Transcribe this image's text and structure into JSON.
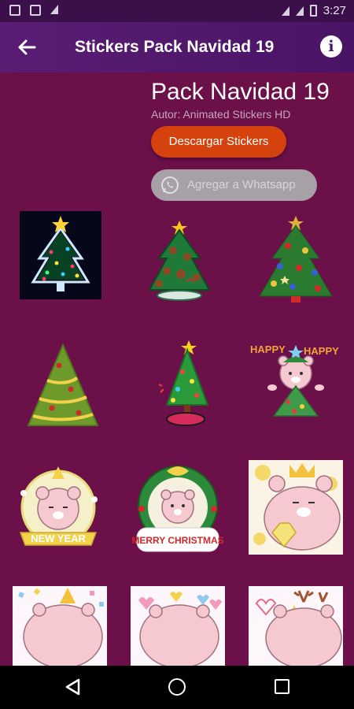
{
  "status_bar": {
    "time": "3:27",
    "left_icons": [
      "gmail-icon",
      "notification-a-icon",
      "play-store-icon"
    ],
    "right_icons": [
      "wifi-icon",
      "no-sim-icon",
      "battery-icon"
    ]
  },
  "app_bar": {
    "title": "Stickers Pack Navidad 19",
    "back_icon": "arrow-left-icon",
    "info_icon": "info-icon",
    "info_glyph": "i"
  },
  "pack": {
    "title": "Pack Navidad 19",
    "author": "Autor: Animated Stickers HD"
  },
  "buttons": {
    "download_label": "Descargar Stickers",
    "whatsapp_label": "Agregar a Whatsapp"
  },
  "stickers": [
    {
      "name": "neon-christmas-tree-sticker",
      "text": ""
    },
    {
      "name": "cookie-christmas-tree-sticker",
      "text": ""
    },
    {
      "name": "ornament-christmas-tree-sticker",
      "text": ""
    },
    {
      "name": "tinsel-christmas-tree-sticker",
      "text": ""
    },
    {
      "name": "small-christmas-tree-sticker",
      "text": ""
    },
    {
      "name": "happy-bear-tree-sticker",
      "text": "HAPPY"
    },
    {
      "name": "new-year-bear-sticker",
      "text": "NEW YEAR"
    },
    {
      "name": "merry-christmas-bear-sticker",
      "text": "MERRY CHRISTMAS"
    },
    {
      "name": "crown-bear-diamond-sticker",
      "text": ""
    },
    {
      "name": "confetti-bear-sticker",
      "text": ""
    },
    {
      "name": "hearts-bear-sticker",
      "text": ""
    },
    {
      "name": "reindeer-bear-sticker",
      "text": ""
    }
  ],
  "nav_bar": {
    "icons": [
      "nav-back-icon",
      "nav-home-icon",
      "nav-recents-icon"
    ]
  },
  "colors": {
    "background": "#6b1049",
    "app_bar": "#4a1466",
    "status_bar": "#3b0f4a",
    "download_button": "#d5420d",
    "whatsapp_button": "#a7a0a7"
  }
}
